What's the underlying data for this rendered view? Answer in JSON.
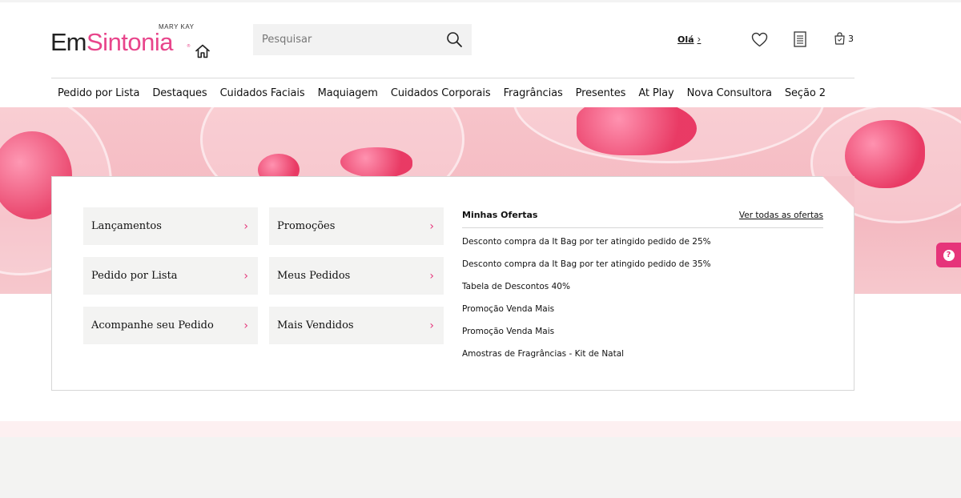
{
  "brand": {
    "top_line": "MARY KAY",
    "em": "Em",
    "sintonia": "Sintonia",
    "tm": "®"
  },
  "header": {
    "search_placeholder": "Pesquisar",
    "greeting": "Olá",
    "greeting_chevron": "›",
    "bag_count": "3",
    "icons": [
      "home-icon",
      "search-icon",
      "heart-icon",
      "order-list-icon",
      "shopping-bag-icon"
    ]
  },
  "nav": {
    "items": [
      "Pedido por Lista",
      "Destaques",
      "Cuidados Faciais",
      "Maquiagem",
      "Cuidados Corporais",
      "Fragrâncias",
      "Presentes",
      "At Play",
      "Nova Consultora",
      "Seção 2"
    ]
  },
  "quick_links": {
    "arrow": "›",
    "items": [
      "Lançamentos",
      "Promoções",
      "Pedido por Lista",
      "Meus Pedidos",
      "Acompanhe seu Pedido",
      "Mais Vendidos"
    ]
  },
  "offers": {
    "title": "Minhas Ofertas",
    "see_all": "Ver todas as ofertas",
    "items": [
      "Desconto compra da It Bag por ter atingido pedido de 25%",
      "Desconto compra da It Bag por ter atingido pedido de 35%",
      "Tabela de Descontos 40%",
      "Promoção Venda Mais",
      "Promoção Venda Mais",
      "Amostras de Fragrâncias - Kit de Natal"
    ]
  },
  "help": {
    "glyph": "?"
  },
  "colors": {
    "brand_pink": "#e8458b",
    "accent": "#e6347a",
    "hero_bg": "#f4b9c1",
    "tile_bg": "#f3f3f2"
  }
}
